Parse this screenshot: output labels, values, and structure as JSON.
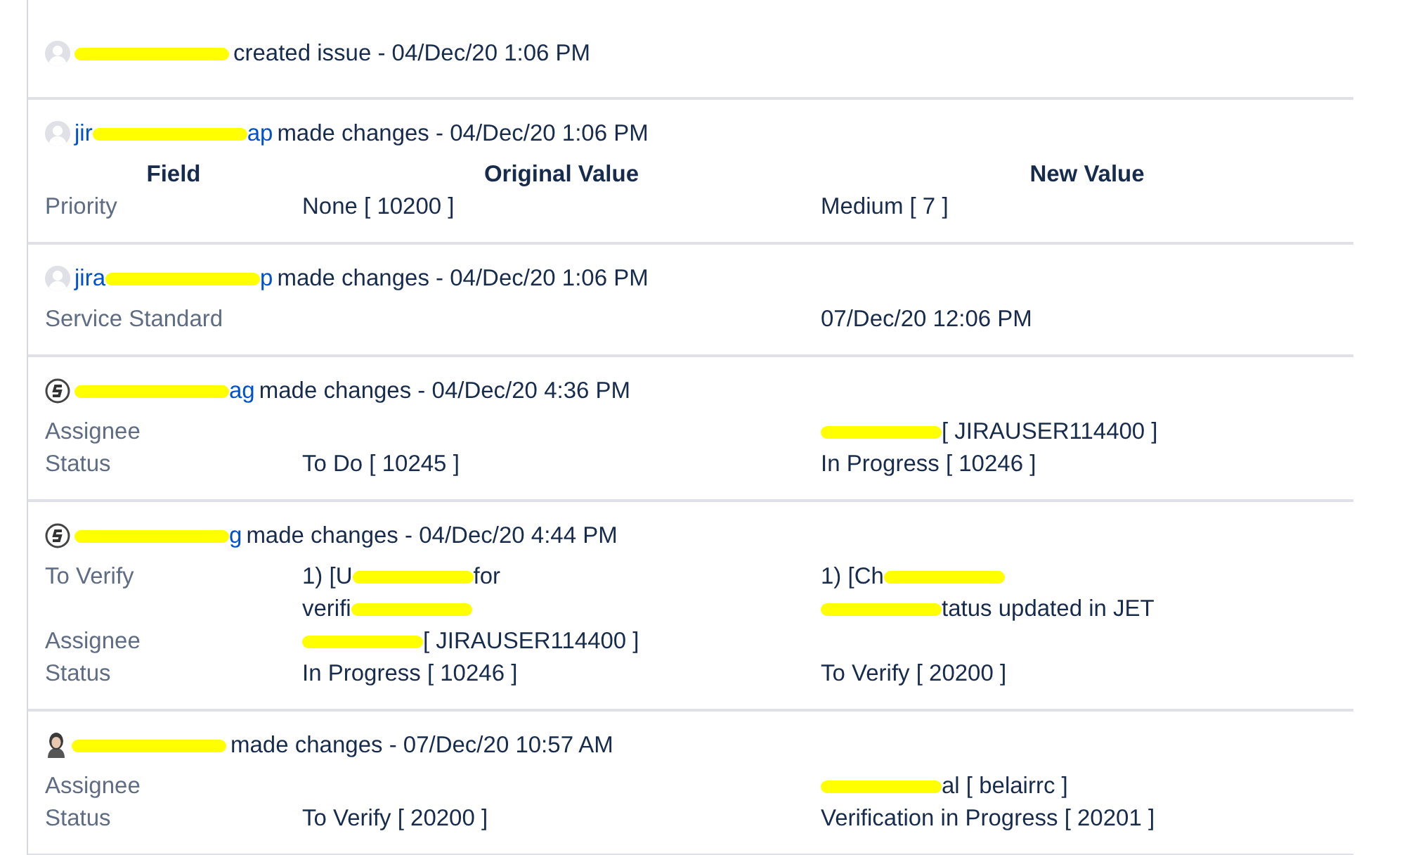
{
  "entries": [
    {
      "avatar": {
        "kind": "default"
      },
      "author": [
        {
          "kind": "mark"
        }
      ],
      "action": "created issue - 04/Dec/20 1:06 PM"
    },
    {
      "avatar": {
        "kind": "default"
      },
      "author": [
        {
          "kind": "text",
          "text": "jir"
        },
        {
          "kind": "mark"
        },
        {
          "kind": "text",
          "text": "ap"
        }
      ],
      "action": "made changes - 04/Dec/20 1:06 PM",
      "header": {
        "field": "Field",
        "original": "Original Value",
        "new": "New Value"
      },
      "rows": [
        {
          "field": "Priority",
          "original": [
            {
              "kind": "text",
              "text": "None [ 10200 ]"
            }
          ],
          "new": [
            {
              "kind": "text",
              "text": "Medium [ 7 ]"
            }
          ]
        }
      ]
    },
    {
      "avatar": {
        "kind": "default"
      },
      "author": [
        {
          "kind": "text",
          "text": "jira"
        },
        {
          "kind": "mark"
        },
        {
          "kind": "text",
          "text": "p"
        }
      ],
      "action": "made changes - 04/Dec/20 1:06 PM",
      "rows": [
        {
          "field": "Service Standard",
          "original": [],
          "new": [
            {
              "kind": "text",
              "text": "07/Dec/20 12:06 PM"
            }
          ]
        }
      ]
    },
    {
      "avatar": {
        "kind": "logo"
      },
      "author": [
        {
          "kind": "mark"
        },
        {
          "kind": "text",
          "text": "ag"
        }
      ],
      "action": "made changes - 04/Dec/20 4:36 PM",
      "rows": [
        {
          "field": "Assignee",
          "original": [],
          "new": [
            {
              "kind": "mark"
            },
            {
              "kind": "text",
              "text": "[ JIRAUSER114400 ]"
            }
          ]
        },
        {
          "field": "Status",
          "original": [
            {
              "kind": "text",
              "text": "To Do [ 10245 ]"
            }
          ],
          "new": [
            {
              "kind": "text",
              "text": "In Progress [ 10246 ]"
            }
          ]
        }
      ]
    },
    {
      "avatar": {
        "kind": "logo"
      },
      "author": [
        {
          "kind": "mark"
        },
        {
          "kind": "text",
          "text": "g"
        }
      ],
      "action": "made changes - 04/Dec/20 4:44 PM",
      "rows": [
        {
          "field": "To Verify",
          "original": [
            {
              "kind": "text",
              "text": "1) [U"
            },
            {
              "kind": "mark"
            },
            {
              "kind": "text",
              "text": "for"
            },
            {
              "kind": "break"
            },
            {
              "kind": "text",
              "text": "verifi"
            },
            {
              "kind": "mark"
            }
          ],
          "new": [
            {
              "kind": "text",
              "text": "1) [Ch"
            },
            {
              "kind": "mark"
            },
            {
              "kind": "break"
            },
            {
              "kind": "mark"
            },
            {
              "kind": "text",
              "text": "tatus updated in JET"
            }
          ]
        },
        {
          "field": "Assignee",
          "original": [
            {
              "kind": "mark"
            },
            {
              "kind": "text",
              "text": "[ JIRAUSER114400 ]"
            }
          ],
          "new": []
        },
        {
          "field": "Status",
          "original": [
            {
              "kind": "text",
              "text": "In Progress [ 10246 ]"
            }
          ],
          "new": [
            {
              "kind": "text",
              "text": "To Verify [ 20200 ]"
            }
          ]
        }
      ]
    },
    {
      "avatar": {
        "kind": "person"
      },
      "author": [
        {
          "kind": "mark"
        }
      ],
      "action": "made changes - 07/Dec/20 10:57 AM",
      "rows": [
        {
          "field": "Assignee",
          "original": [],
          "new": [
            {
              "kind": "mark"
            },
            {
              "kind": "text",
              "text": "al [ belairrc ]"
            }
          ]
        },
        {
          "field": "Status",
          "original": [
            {
              "kind": "text",
              "text": "To Verify [ 20200 ]"
            }
          ],
          "new": [
            {
              "kind": "text",
              "text": "Verification in Progress [ 20201 ]"
            }
          ]
        }
      ]
    }
  ]
}
